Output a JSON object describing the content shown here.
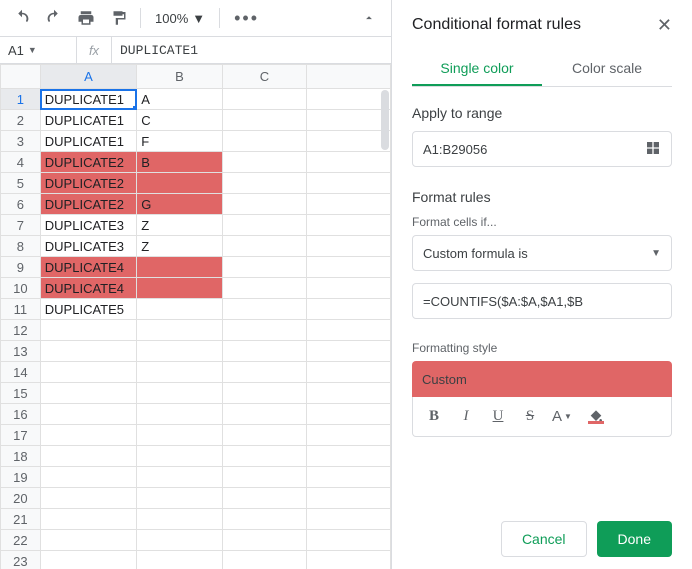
{
  "toolbar": {
    "zoom": "100%"
  },
  "formula_bar": {
    "cell_ref": "A1",
    "fx": "fx",
    "value": "DUPLICATE1"
  },
  "columns": [
    "A",
    "B",
    "C"
  ],
  "active_col": "A",
  "active_row": 1,
  "selected_cell": {
    "r": 1,
    "c": 0
  },
  "row_count": 23,
  "cells": [
    {
      "r": 1,
      "c": 0,
      "v": "DUPLICATE1"
    },
    {
      "r": 1,
      "c": 1,
      "v": "A"
    },
    {
      "r": 2,
      "c": 0,
      "v": "DUPLICATE1"
    },
    {
      "r": 2,
      "c": 1,
      "v": "C"
    },
    {
      "r": 3,
      "c": 0,
      "v": "DUPLICATE1"
    },
    {
      "r": 3,
      "c": 1,
      "v": "F"
    },
    {
      "r": 4,
      "c": 0,
      "v": "DUPLICATE2",
      "hl": true
    },
    {
      "r": 4,
      "c": 1,
      "v": "B",
      "hl": true
    },
    {
      "r": 5,
      "c": 0,
      "v": "DUPLICATE2",
      "hl": true
    },
    {
      "r": 5,
      "c": 1,
      "v": "",
      "hl": true
    },
    {
      "r": 6,
      "c": 0,
      "v": "DUPLICATE2",
      "hl": true
    },
    {
      "r": 6,
      "c": 1,
      "v": "G",
      "hl": true
    },
    {
      "r": 7,
      "c": 0,
      "v": "DUPLICATE3"
    },
    {
      "r": 7,
      "c": 1,
      "v": "Z"
    },
    {
      "r": 8,
      "c": 0,
      "v": "DUPLICATE3"
    },
    {
      "r": 8,
      "c": 1,
      "v": "Z"
    },
    {
      "r": 9,
      "c": 0,
      "v": "DUPLICATE4",
      "hl": true
    },
    {
      "r": 9,
      "c": 1,
      "v": "",
      "hl": true
    },
    {
      "r": 10,
      "c": 0,
      "v": "DUPLICATE4",
      "hl": true
    },
    {
      "r": 10,
      "c": 1,
      "v": "",
      "hl": true
    },
    {
      "r": 11,
      "c": 0,
      "v": "DUPLICATE5"
    }
  ],
  "panel": {
    "title": "Conditional format rules",
    "tabs": {
      "single": "Single color",
      "scale": "Color scale"
    },
    "apply_label": "Apply to range",
    "range": "A1:B29056",
    "rules_label": "Format rules",
    "cells_if_label": "Format cells if...",
    "condition": "Custom formula is",
    "formula": "=COUNTIFS($A:$A,$A1,$B",
    "style_label": "Formatting style",
    "style_name": "Custom",
    "fmt": {
      "bold": "B",
      "italic": "I",
      "underline": "U",
      "strike": "S",
      "textcolor": "A"
    },
    "cancel": "Cancel",
    "done": "Done"
  }
}
